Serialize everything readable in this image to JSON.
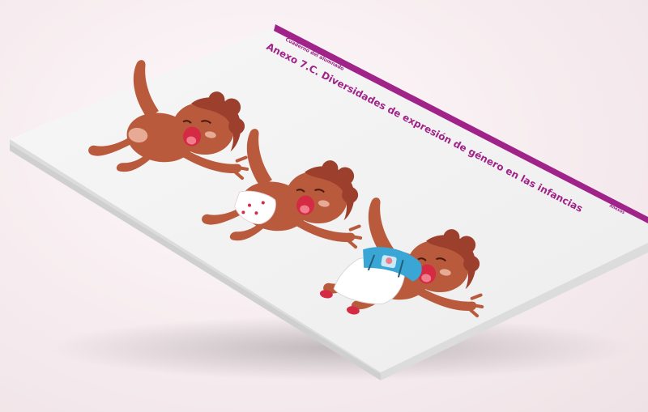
{
  "document": {
    "header_subtitle": "Cuaderno del alumnado",
    "title": "Anexo 7.C. Diversidades de expresión de género en las infancias",
    "side_tab": "Anexos"
  },
  "colors": {
    "accent": "#a0238a",
    "skin": "#b95a3c",
    "hair": "#9c3f2c",
    "mouth": "#d42a44",
    "shirt": "#3aa6d6",
    "paper": "#f4f4f4"
  },
  "figures": [
    {
      "name": "baby-nude",
      "clothing": "none"
    },
    {
      "name": "baby-diaper",
      "clothing": "diaper with hearts"
    },
    {
      "name": "baby-overalls",
      "clothing": "blue t-shirt with unicorn and white overalls"
    }
  ]
}
